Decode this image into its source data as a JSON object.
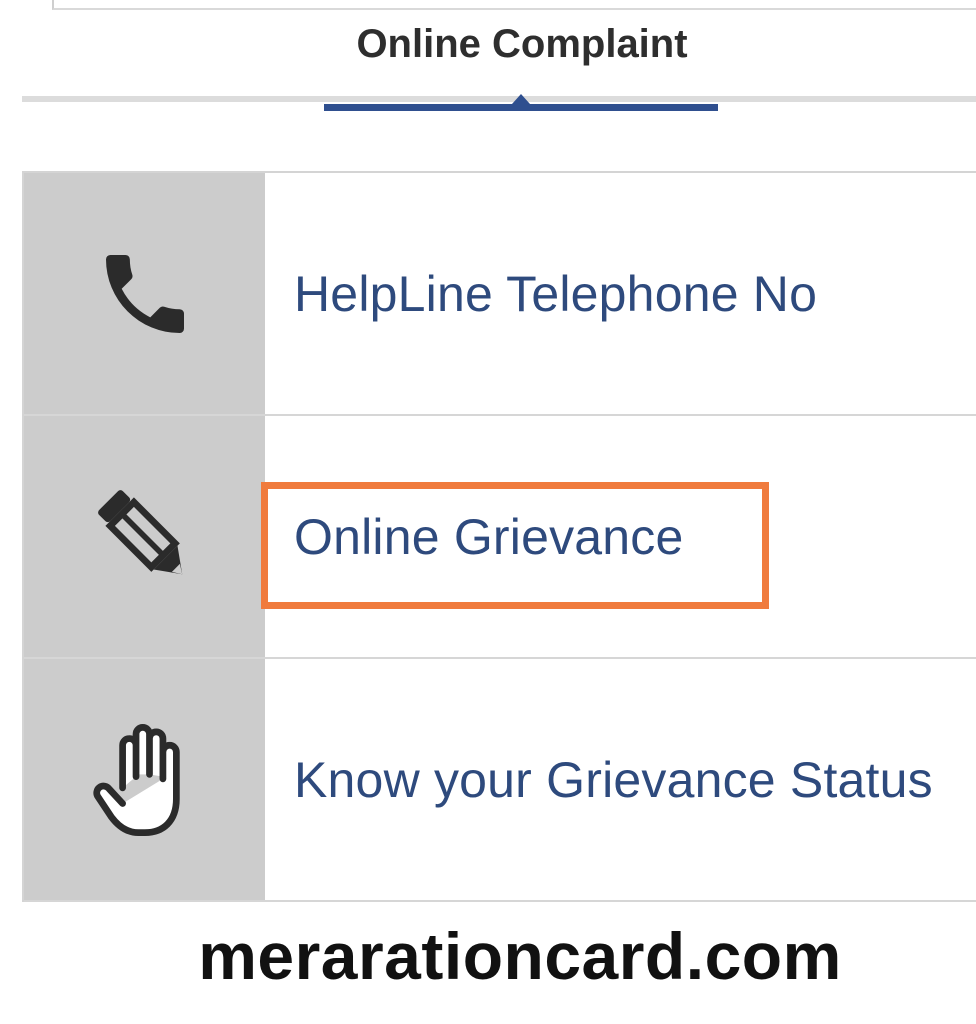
{
  "header": {
    "title": "Online Complaint"
  },
  "menu": {
    "items": [
      {
        "icon": "phone-icon",
        "label": "HelpLine Telephone No"
      },
      {
        "icon": "pencil-icon",
        "label": "Online Grievance",
        "highlighted": true
      },
      {
        "icon": "hand-icon",
        "label": "Know your Grievance Status"
      }
    ]
  },
  "watermark": {
    "text": "meraration​card.com"
  },
  "colors": {
    "label_text": "#2e4a7d",
    "accent_underline": "#2f4f8f",
    "icon_background": "#cccccc",
    "highlight_border": "#f07b3d"
  }
}
